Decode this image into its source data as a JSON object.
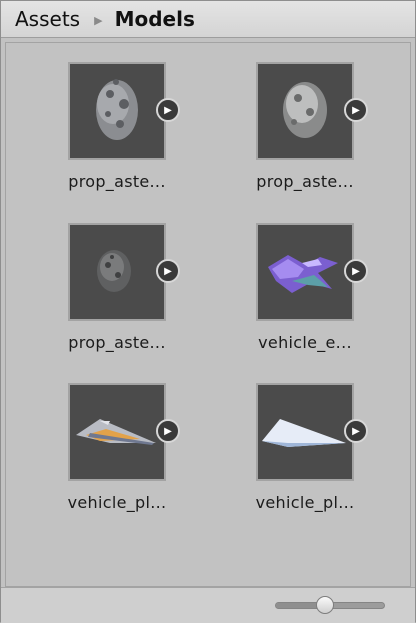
{
  "breadcrumb": {
    "root": "Assets",
    "separator": "▶",
    "current": "Models"
  },
  "assets": [
    {
      "label": "prop_aste...",
      "thumb": "asteroid-dark",
      "preview_icon": "play-icon"
    },
    {
      "label": "prop_aste...",
      "thumb": "asteroid-light",
      "preview_icon": "play-icon"
    },
    {
      "label": "prop_aste...",
      "thumb": "asteroid-small",
      "preview_icon": "play-icon"
    },
    {
      "label": "vehicle_e...",
      "thumb": "vehicle-purple",
      "preview_icon": "play-icon"
    },
    {
      "label": "vehicle_pl...",
      "thumb": "vehicle-plane-orange",
      "preview_icon": "play-icon"
    },
    {
      "label": "vehicle_pl...",
      "thumb": "vehicle-plane-white",
      "preview_icon": "play-icon"
    }
  ],
  "zoom": {
    "level": 0.45
  },
  "colors": {
    "thumb_bg": "#4b4b4b",
    "panel_bg": "#c2c2c2",
    "play_bg": "#3a3a3a"
  }
}
